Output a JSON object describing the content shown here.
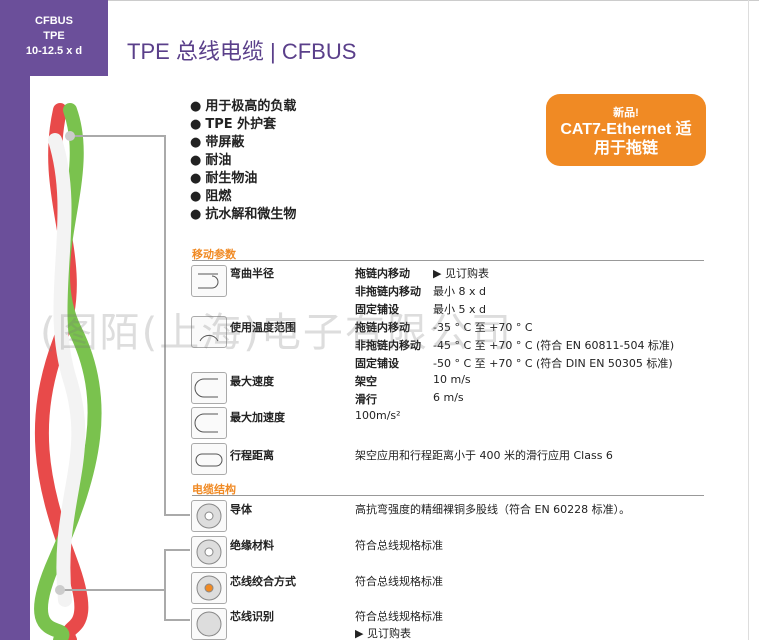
{
  "badge": {
    "line1": "CFBUS",
    "line2": "TPE",
    "line3": "10-12.5 x d"
  },
  "title": "TPE 总线电缆 | CFBUS",
  "features": [
    "用于极高的负载",
    "TPE 外护套",
    "带屏蔽",
    "耐油",
    "耐生物油",
    "阻燃",
    "抗水解和微生物"
  ],
  "new_box": {
    "small": "新品!",
    "big1": "CAT7-Ethernet 适",
    "big2": "用于拖链"
  },
  "motion": {
    "heading": "移动参数",
    "bend": {
      "label": "弯曲半径",
      "rows": [
        {
          "k": "拖链内移动",
          "v": "▶ 见订购表"
        },
        {
          "k": "非拖链内移动",
          "v": "最小 8 x d"
        },
        {
          "k": "固定铺设",
          "v": "最小 5 x d"
        }
      ]
    },
    "temp": {
      "label": "使用温度范围",
      "rows": [
        {
          "k": "拖链内移动",
          "v": "-35 ° C 至 +70 ° C"
        },
        {
          "k": "非拖链内移动",
          "v": "-45 ° C 至 +70 ° C (符合 EN 60811-504 标准)"
        },
        {
          "k": "固定铺设",
          "v": "-50 ° C 至 +70 ° C (符合 DIN EN 50305 标准)"
        }
      ]
    },
    "speed": {
      "label": "最大速度",
      "rows": [
        {
          "k": "架空",
          "v": "10 m/s"
        },
        {
          "k": "滑行",
          "v": "6 m/s"
        }
      ]
    },
    "accel": {
      "label": "最大加速度",
      "value": "100m/s²"
    },
    "travel": {
      "label": "行程距离",
      "value": "架空应用和行程距离小于 400 米的滑行应用 Class 6"
    }
  },
  "structure": {
    "heading": "电缆结构",
    "items": [
      {
        "label": "导体",
        "value": "高抗弯强度的精细裸铜多股线（符合 EN 60228 标准）。"
      },
      {
        "label": "绝缘材料",
        "value": "符合总线规格标准"
      },
      {
        "label": "芯线绞合方式",
        "value": "符合总线规格标准"
      },
      {
        "label": "芯线识别",
        "value": "符合总线规格标准",
        "extra": "▶ 见订购表"
      }
    ]
  },
  "watermark": "(图陌(上海)电子有限公司"
}
